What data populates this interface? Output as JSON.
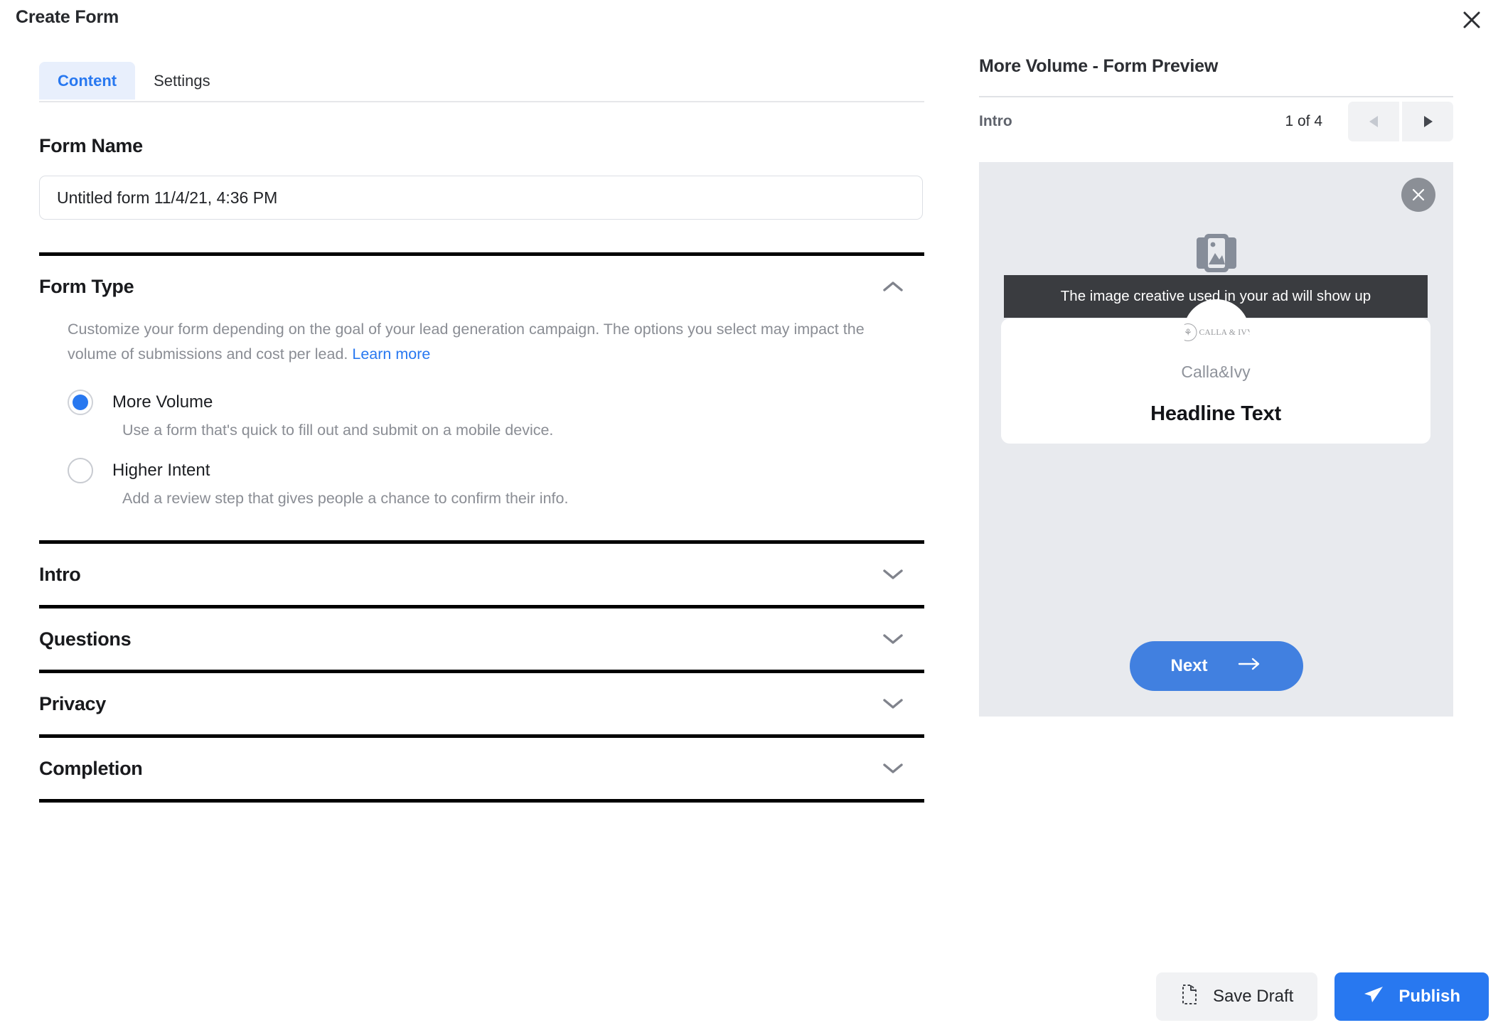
{
  "modal": {
    "title": "Create Form",
    "close_icon": "close-icon"
  },
  "tabs": [
    {
      "label": "Content",
      "active": true
    },
    {
      "label": "Settings",
      "active": false
    }
  ],
  "form_name": {
    "heading": "Form Name",
    "value": "Untitled form 11/4/21, 4:36 PM",
    "placeholder": "Untitled form"
  },
  "form_type": {
    "heading": "Form Type",
    "expanded": true,
    "chevron_icon": "chevron-up-icon",
    "description_part1": "Customize your form depending on the goal of your lead generation campaign. The options you select may impact the volume of submissions and cost per lead.",
    "learn_more": "Learn more",
    "options": [
      {
        "label": "More Volume",
        "description": "Use a form that's quick to fill out and submit on a mobile device.",
        "selected": true
      },
      {
        "label": "Higher Intent",
        "description": "Add a review step that gives people a chance to confirm their info.",
        "selected": false
      }
    ]
  },
  "sections": [
    {
      "heading": "Intro",
      "chevron_icon": "chevron-down-icon"
    },
    {
      "heading": "Questions",
      "chevron_icon": "chevron-down-icon"
    },
    {
      "heading": "Privacy",
      "chevron_icon": "chevron-down-icon"
    },
    {
      "heading": "Completion",
      "chevron_icon": "chevron-down-icon"
    }
  ],
  "preview": {
    "title": "More Volume - Form Preview",
    "step_label": "Intro",
    "counter": "1 of 4",
    "prev_icon": "triangle-left-icon",
    "next_icon": "triangle-right-icon",
    "prev_enabled": false,
    "next_enabled": true,
    "close_icon": "close-circle-icon",
    "image_placeholder_icon": "photos-icon",
    "tooltip": "The image creative used in your ad will show up",
    "avatar_mark": "⚘",
    "avatar_word": "CALLA & IVY",
    "brand_name": "Calla&Ivy",
    "headline": "Headline Text",
    "next_button": "Next",
    "next_button_icon": "arrow-right-icon"
  },
  "footer": {
    "save_draft": "Save Draft",
    "save_draft_icon": "file-dashed-icon",
    "publish": "Publish",
    "publish_icon": "paper-plane-icon"
  },
  "colors": {
    "accent": "#2878f0",
    "tab_active_bg": "#e8effc",
    "preview_bg": "#e8eaee",
    "tooltip_bg": "#3a3c40",
    "next_button": "#4180e0",
    "muted_text": "#8a8d94"
  }
}
